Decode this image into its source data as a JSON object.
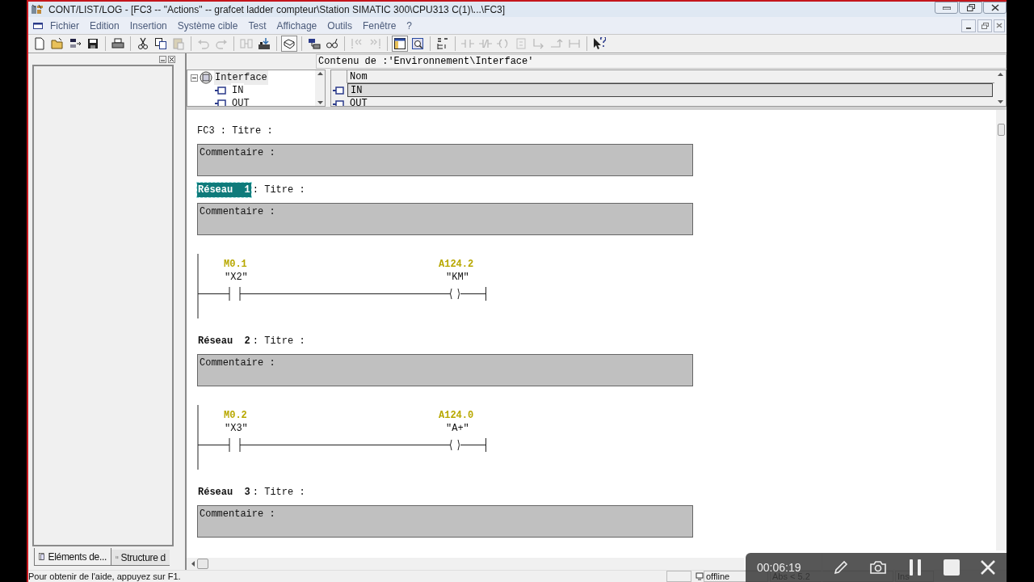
{
  "window": {
    "title": "CONT/LIST/LOG - [FC3 -- \"Actions\" -- grafcet ladder compteur\\Station SIMATIC 300\\CPU313 C(1)\\...\\FC3]"
  },
  "menu": [
    "Fichier",
    "Edition",
    "Insertion",
    "Système cible",
    "Test",
    "Affichage",
    "Outils",
    "Fenêtre",
    "?"
  ],
  "toolbar": [
    {
      "kind": "new",
      "disabled": false,
      "pressed": false
    },
    {
      "kind": "open",
      "disabled": false,
      "pressed": false
    },
    {
      "kind": "nodes",
      "disabled": false,
      "pressed": false
    },
    {
      "kind": "save",
      "disabled": false,
      "pressed": false
    },
    {
      "kind": "sep"
    },
    {
      "kind": "print",
      "disabled": false,
      "pressed": false
    },
    {
      "kind": "sep"
    },
    {
      "kind": "cut",
      "disabled": false,
      "pressed": false
    },
    {
      "kind": "copy",
      "disabled": false,
      "pressed": false
    },
    {
      "kind": "paste",
      "disabled": true,
      "pressed": false
    },
    {
      "kind": "sep"
    },
    {
      "kind": "undo",
      "disabled": true,
      "pressed": false
    },
    {
      "kind": "redo",
      "disabled": true,
      "pressed": false
    },
    {
      "kind": "sep"
    },
    {
      "kind": "compare",
      "disabled": true,
      "pressed": false
    },
    {
      "kind": "download",
      "disabled": false,
      "pressed": false
    },
    {
      "kind": "sep"
    },
    {
      "kind": "window",
      "disabled": false,
      "pressed": true
    },
    {
      "kind": "sep"
    },
    {
      "kind": "network",
      "disabled": false,
      "pressed": false
    },
    {
      "kind": "glasses",
      "disabled": false,
      "pressed": false
    },
    {
      "kind": "sep"
    },
    {
      "kind": "first",
      "disabled": true,
      "pressed": false
    },
    {
      "kind": "last",
      "disabled": true,
      "pressed": false
    },
    {
      "kind": "sep"
    },
    {
      "kind": "layout",
      "disabled": false,
      "pressed": true
    },
    {
      "kind": "zoom",
      "disabled": false,
      "pressed": false
    },
    {
      "kind": "sep"
    },
    {
      "kind": "overview",
      "disabled": false,
      "pressed": false
    },
    {
      "kind": "sep"
    },
    {
      "kind": "contact_no",
      "disabled": true,
      "pressed": false
    },
    {
      "kind": "contact_nc",
      "disabled": true,
      "pressed": false
    },
    {
      "kind": "coil",
      "disabled": true,
      "pressed": false
    },
    {
      "kind": "box",
      "disabled": true,
      "pressed": false
    },
    {
      "kind": "branch_open",
      "disabled": true,
      "pressed": false
    },
    {
      "kind": "branch_close",
      "disabled": true,
      "pressed": false
    },
    {
      "kind": "connection",
      "disabled": true,
      "pressed": false
    },
    {
      "kind": "sep"
    },
    {
      "kind": "help",
      "disabled": false,
      "pressed": false
    }
  ],
  "left_panel": {
    "tabs": [
      {
        "label": "Eléments de...",
        "selected": true
      },
      {
        "label": "Structure d",
        "selected": false
      }
    ]
  },
  "interface": {
    "path": "Contenu de :'Environnement\\Interface'",
    "tree": [
      {
        "label": "Interface",
        "expanded": true,
        "selected": true,
        "children": [
          {
            "label": "IN",
            "selected": false
          },
          {
            "label": "OUT",
            "selected": false
          }
        ]
      }
    ],
    "column": "Nom",
    "rows": [
      {
        "label": "IN",
        "selected": true
      },
      {
        "label": "OUT",
        "selected": false
      }
    ]
  },
  "editor": {
    "block_header": "FC3 : Titre :",
    "block_comment": "Commentaire :",
    "networks": [
      {
        "label": "Réseau",
        "number": "1",
        "selected": true,
        "title": ": Titre :",
        "comment": "Commentaire :",
        "contact": {
          "address": "M0.1",
          "symbol": "\"X2\""
        },
        "coil": {
          "address": "A124.2",
          "symbol": "\"KM\""
        }
      },
      {
        "label": "Réseau",
        "number": "2",
        "selected": false,
        "title": ": Titre :",
        "comment": "Commentaire :",
        "contact": {
          "address": "M0.2",
          "symbol": "\"X3\""
        },
        "coil": {
          "address": "A124.0",
          "symbol": "\"A+\""
        }
      },
      {
        "label": "Réseau",
        "number": "3",
        "selected": false,
        "title": ": Titre :",
        "comment": "Commentaire :"
      }
    ]
  },
  "status_bar": {
    "help": "Pour obtenir de l'aide, appuyez sur F1.",
    "mode": "offline",
    "address": "Abs < 5.2",
    "insert": "Ins"
  },
  "recorder": {
    "time": "00:06:19"
  }
}
